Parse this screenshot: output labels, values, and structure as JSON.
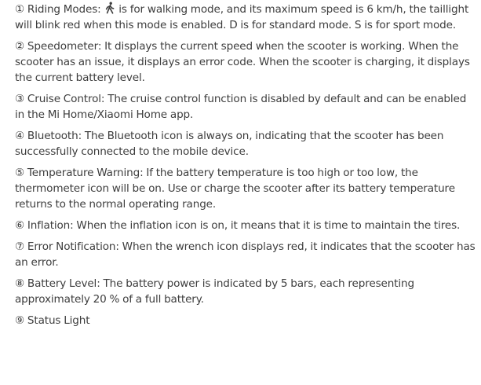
{
  "items": [
    {
      "marker": "①",
      "lead": "Riding Modes: ",
      "icon": "walking-person-icon",
      "text": " is for walking mode, and its maximum speed is 6 km/h, the taillight will blink red when this mode is enabled. D is for standard mode. S is for sport mode."
    },
    {
      "marker": "②",
      "text": "Speedometer: It displays the current speed when the scooter is working. When the scooter has an issue, it displays an error code. When the scooter is charging, it displays the current battery level."
    },
    {
      "marker": "③",
      "text": "Cruise Control: The cruise control function is disabled by default and can be enabled in the Mi Home/Xiaomi Home app."
    },
    {
      "marker": "④",
      "text": "Bluetooth: The Bluetooth icon is always on, indicating that the scooter has been successfully connected to the mobile device."
    },
    {
      "marker": "⑤",
      "text": "Temperature Warning: If the battery temperature is too high or too low, the thermometer icon will be on. Use or charge the scooter after its battery temperature returns to the normal operating range."
    },
    {
      "marker": "⑥",
      "text": "Inflation: When the inflation icon is on, it means that it is time to maintain the tires."
    },
    {
      "marker": "⑦",
      "text": "Error Notification: When the wrench icon displays red, it indicates that the scooter has an error."
    },
    {
      "marker": "⑧",
      "text": "Battery Level: The battery power is indicated by 5 bars, each representing approximately 20 % of a full battery."
    },
    {
      "marker": "⑨",
      "text": "Status Light"
    }
  ]
}
